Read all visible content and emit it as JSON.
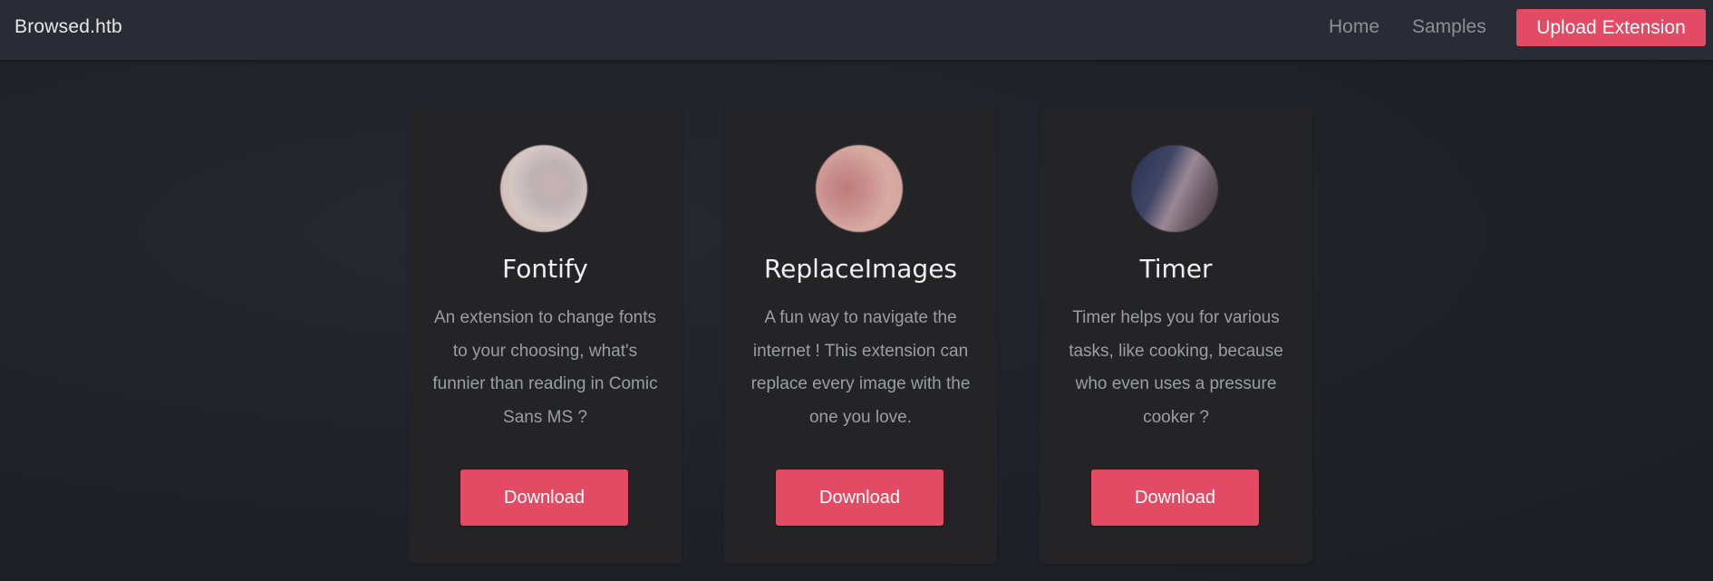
{
  "navbar": {
    "brand": "Browsed.htb",
    "links": [
      {
        "label": "Home"
      },
      {
        "label": "Samples"
      }
    ],
    "upload_label": "Upload Extension"
  },
  "colors": {
    "accent": "#e34a64",
    "background": "#21232b",
    "navbar": "#292c34",
    "card": "#242426"
  },
  "extensions": [
    {
      "name": "Fontify",
      "description": "An extension to change fonts to your choosing, what's funnier than reading in Comic Sans MS ?",
      "download_label": "Download"
    },
    {
      "name": "ReplaceImages",
      "description": "A fun way to navigate the internet ! This extension can replace every image with the one you love.",
      "download_label": "Download"
    },
    {
      "name": "Timer",
      "description": "Timer helps you for various tasks, like cooking, because who even uses a pressure cooker ?",
      "download_label": "Download"
    }
  ]
}
